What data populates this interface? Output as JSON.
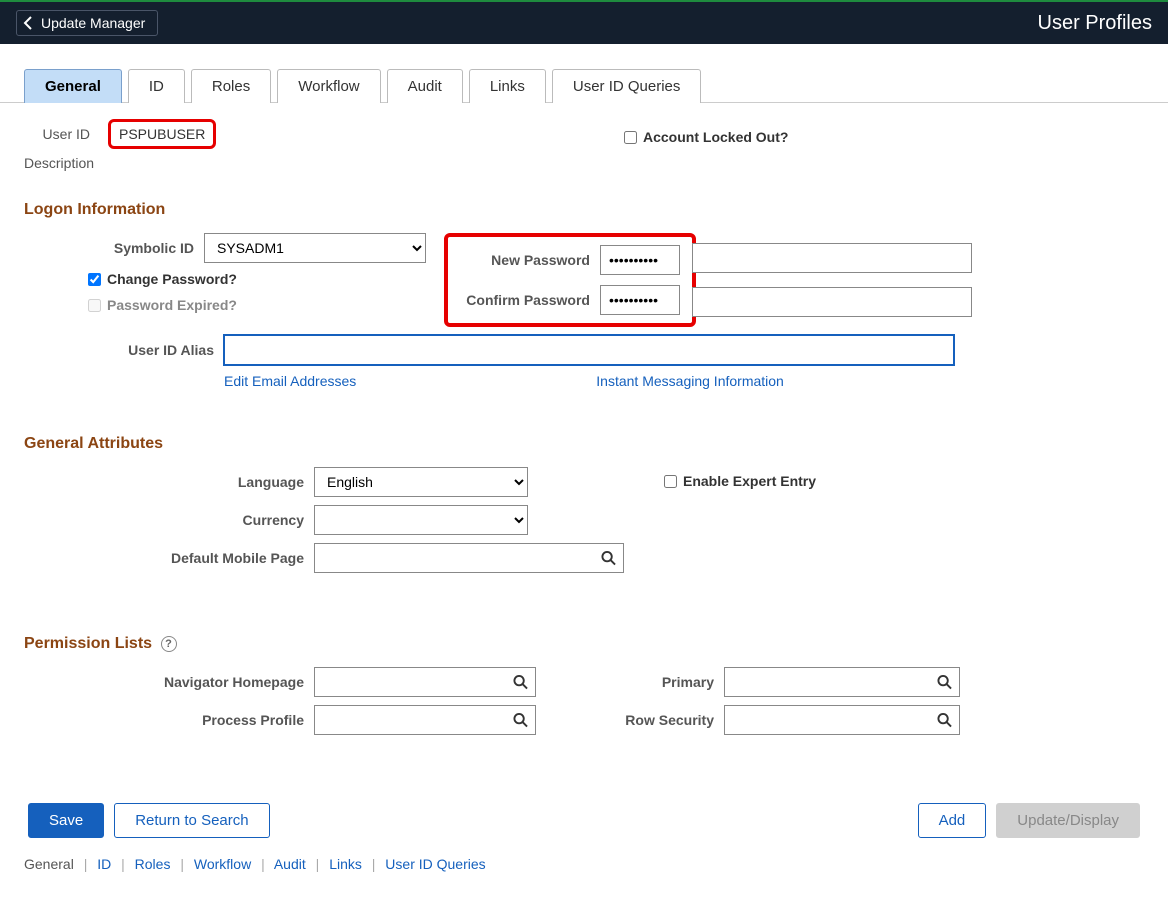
{
  "topbar": {
    "back_label": "Update Manager",
    "title": "User Profiles"
  },
  "tabs": [
    "General",
    "ID",
    "Roles",
    "Workflow",
    "Audit",
    "Links",
    "User ID Queries"
  ],
  "active_tab_index": 0,
  "header_fields": {
    "user_id_label": "User ID",
    "user_id_value": "PSPUBUSER",
    "description_label": "Description",
    "account_locked_label": "Account Locked Out?",
    "account_locked_checked": false
  },
  "logon": {
    "heading": "Logon Information",
    "symbolic_id_label": "Symbolic ID",
    "symbolic_id_value": "SYSADM1",
    "change_pw_label": "Change Password?",
    "change_pw_checked": true,
    "pw_expired_label": "Password Expired?",
    "pw_expired_checked": false,
    "new_pw_label": "New Password",
    "new_pw_value": "••••••••••",
    "confirm_pw_label": "Confirm Password",
    "confirm_pw_value": "••••••••••",
    "alias_label": "User ID Alias",
    "alias_value": "",
    "edit_email_link": "Edit Email Addresses",
    "im_link": "Instant Messaging Information"
  },
  "general_attrs": {
    "heading": "General Attributes",
    "language_label": "Language",
    "language_value": "English",
    "currency_label": "Currency",
    "currency_value": "",
    "enable_expert_label": "Enable Expert Entry",
    "enable_expert_checked": false,
    "default_mobile_label": "Default Mobile Page",
    "default_mobile_value": ""
  },
  "permission": {
    "heading": "Permission Lists",
    "nav_homepage_label": "Navigator Homepage",
    "nav_homepage_value": "",
    "process_profile_label": "Process Profile",
    "process_profile_value": "",
    "primary_label": "Primary",
    "primary_value": "",
    "row_security_label": "Row Security",
    "row_security_value": ""
  },
  "buttons": {
    "save": "Save",
    "return_search": "Return to Search",
    "add": "Add",
    "update_display": "Update/Display"
  },
  "footer_links": [
    "General",
    "ID",
    "Roles",
    "Workflow",
    "Audit",
    "Links",
    "User ID Queries"
  ]
}
